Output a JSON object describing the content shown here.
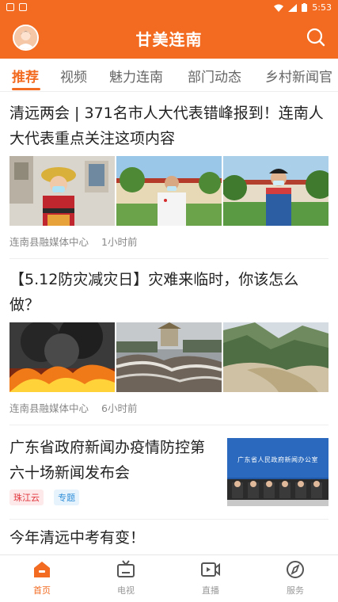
{
  "status_bar": {
    "time": "5:53"
  },
  "header": {
    "title": "甘美连南"
  },
  "tabs": [
    {
      "label": "推荐"
    },
    {
      "label": "视频"
    },
    {
      "label": "魅力连南"
    },
    {
      "label": "部门动态"
    },
    {
      "label": "乡村新闻官"
    }
  ],
  "articles": [
    {
      "headline": "清远两会 | 371名市人大代表错峰报到！连南人大代表重点关注这项内容",
      "source": "连南县融媒体中心",
      "time": "1小时前"
    },
    {
      "headline": "【5.12防灾减灾日】灾难来临时，你该怎么做？",
      "source": "连南县融媒体中心",
      "time": "6小时前"
    },
    {
      "headline": "广东省政府新闻办疫情防控第六十场新闻发布会",
      "tags": [
        "珠江云",
        "专题"
      ],
      "thumb_banner": "广东省人民政府新闻办公室"
    },
    {
      "headline": "今年清远中考有变！"
    }
  ],
  "bottom_nav": [
    {
      "label": "首页",
      "icon": "home-icon"
    },
    {
      "label": "电视",
      "icon": "tv-icon"
    },
    {
      "label": "直播",
      "icon": "live-icon"
    },
    {
      "label": "服务",
      "icon": "compass-icon"
    }
  ],
  "colors": {
    "accent": "#f26b21",
    "tag_red": "#e0343a",
    "tag_blue": "#2f8fd8"
  }
}
